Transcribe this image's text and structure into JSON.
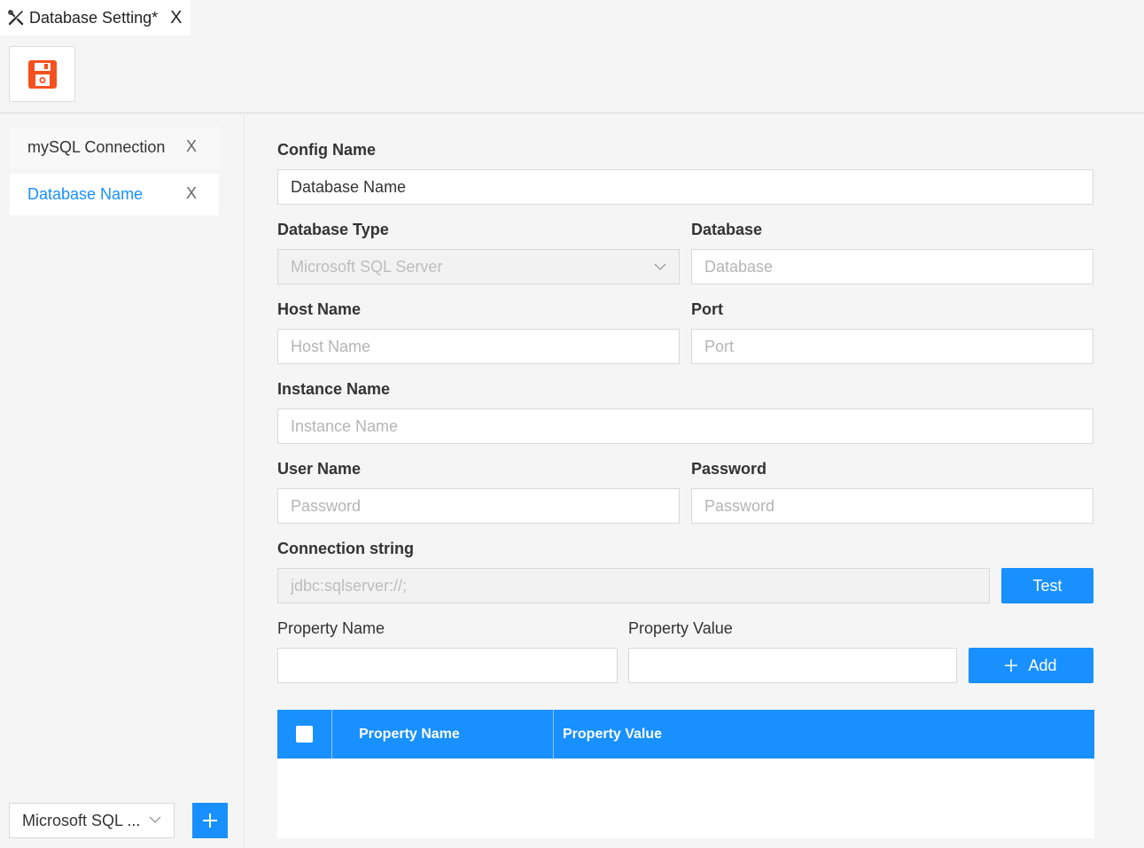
{
  "tab": {
    "title": "Database Setting*",
    "close": "X",
    "tool_icon": "wrench-screwdriver-icon"
  },
  "toolbar": {
    "save_icon": "save-icon",
    "save_color": "#f4511e"
  },
  "connections": [
    {
      "label": "mySQL Connection",
      "close": "X",
      "active": false
    },
    {
      "label": "Database Name",
      "close": "X",
      "active": true
    }
  ],
  "bottom": {
    "db_type_value": "Microsoft SQL ...",
    "add_icon": "plus-icon"
  },
  "form": {
    "config_name_label": "Config Name",
    "config_name_value": "Database Name",
    "database_type_label": "Database Type",
    "database_type_value": "Microsoft SQL Server",
    "database_label": "Database",
    "database_placeholder": "Database",
    "host_name_label": "Host Name",
    "host_name_placeholder": "Host Name",
    "port_label": "Port",
    "port_placeholder": "Port",
    "instance_name_label": "Instance Name",
    "instance_name_placeholder": "Instance Name",
    "user_name_label": "User Name",
    "user_name_placeholder": "Password",
    "password_label": "Password",
    "password_placeholder": "Password",
    "connection_string_label": "Connection string",
    "connection_string_value": "jdbc:sqlserver://;",
    "test_button": "Test",
    "property_name_label": "Property Name",
    "property_value_label": "Property Value",
    "add_button": "Add"
  },
  "table": {
    "headers": [
      "Property Name",
      "Property Value"
    ],
    "rows": []
  },
  "colors": {
    "accent": "#1890ff",
    "save": "#f4511e"
  }
}
